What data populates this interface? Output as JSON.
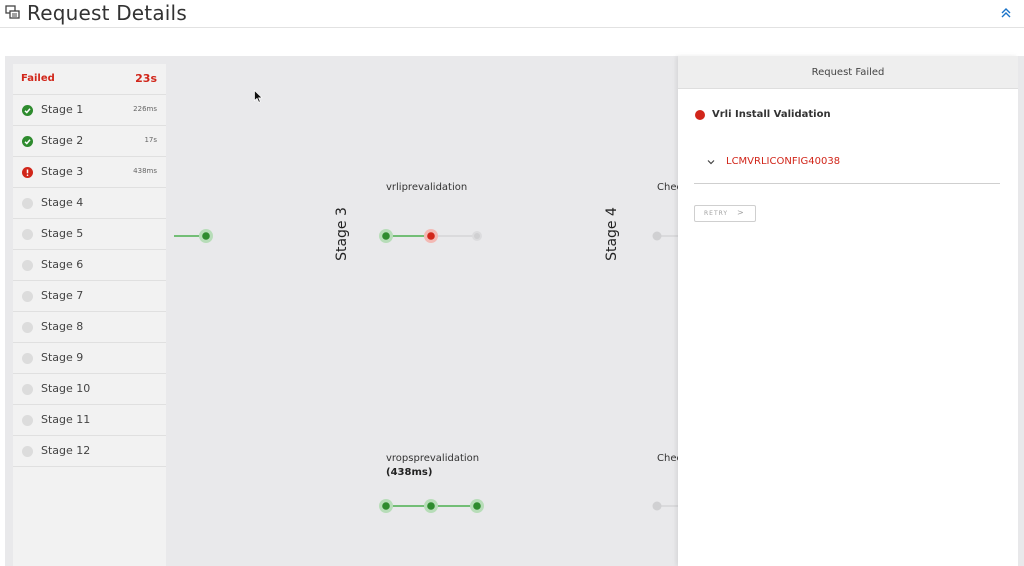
{
  "header": {
    "title": "Request Details"
  },
  "stage_list": {
    "status_label": "Failed",
    "status_time": "23s",
    "stages": [
      {
        "label": "Stage 1",
        "status": "success",
        "time": "226ms"
      },
      {
        "label": "Stage 2",
        "status": "success",
        "time": "17s"
      },
      {
        "label": "Stage 3",
        "status": "failed",
        "time": "438ms"
      },
      {
        "label": "Stage 4",
        "status": "pending",
        "time": ""
      },
      {
        "label": "Stage 5",
        "status": "pending",
        "time": ""
      },
      {
        "label": "Stage 6",
        "status": "pending",
        "time": ""
      },
      {
        "label": "Stage 7",
        "status": "pending",
        "time": ""
      },
      {
        "label": "Stage 8",
        "status": "pending",
        "time": ""
      },
      {
        "label": "Stage 9",
        "status": "pending",
        "time": ""
      },
      {
        "label": "Stage 10",
        "status": "pending",
        "time": ""
      },
      {
        "label": "Stage 11",
        "status": "pending",
        "time": ""
      },
      {
        "label": "Stage 12",
        "status": "pending",
        "time": ""
      }
    ]
  },
  "pipeline": {
    "stage3_title": "Stage 3",
    "stage4_title": "Stage 4",
    "task_vrli": "vrliprevalidation",
    "task_vrops": "vropsprevalidation",
    "task_vrops_time": "(438ms)",
    "task_check_top": "Chec",
    "task_check_bottom": "Chec"
  },
  "panel": {
    "title": "Request Failed",
    "task_name": "Vrli Install Validation",
    "error_code": "LCMVRLICONFIG40038",
    "retry_label": "RETRY"
  },
  "colors": {
    "success": "#2e8b2e",
    "failed": "#d1261a",
    "pending": "#dcdcdc",
    "accent": "#1a73c8"
  }
}
